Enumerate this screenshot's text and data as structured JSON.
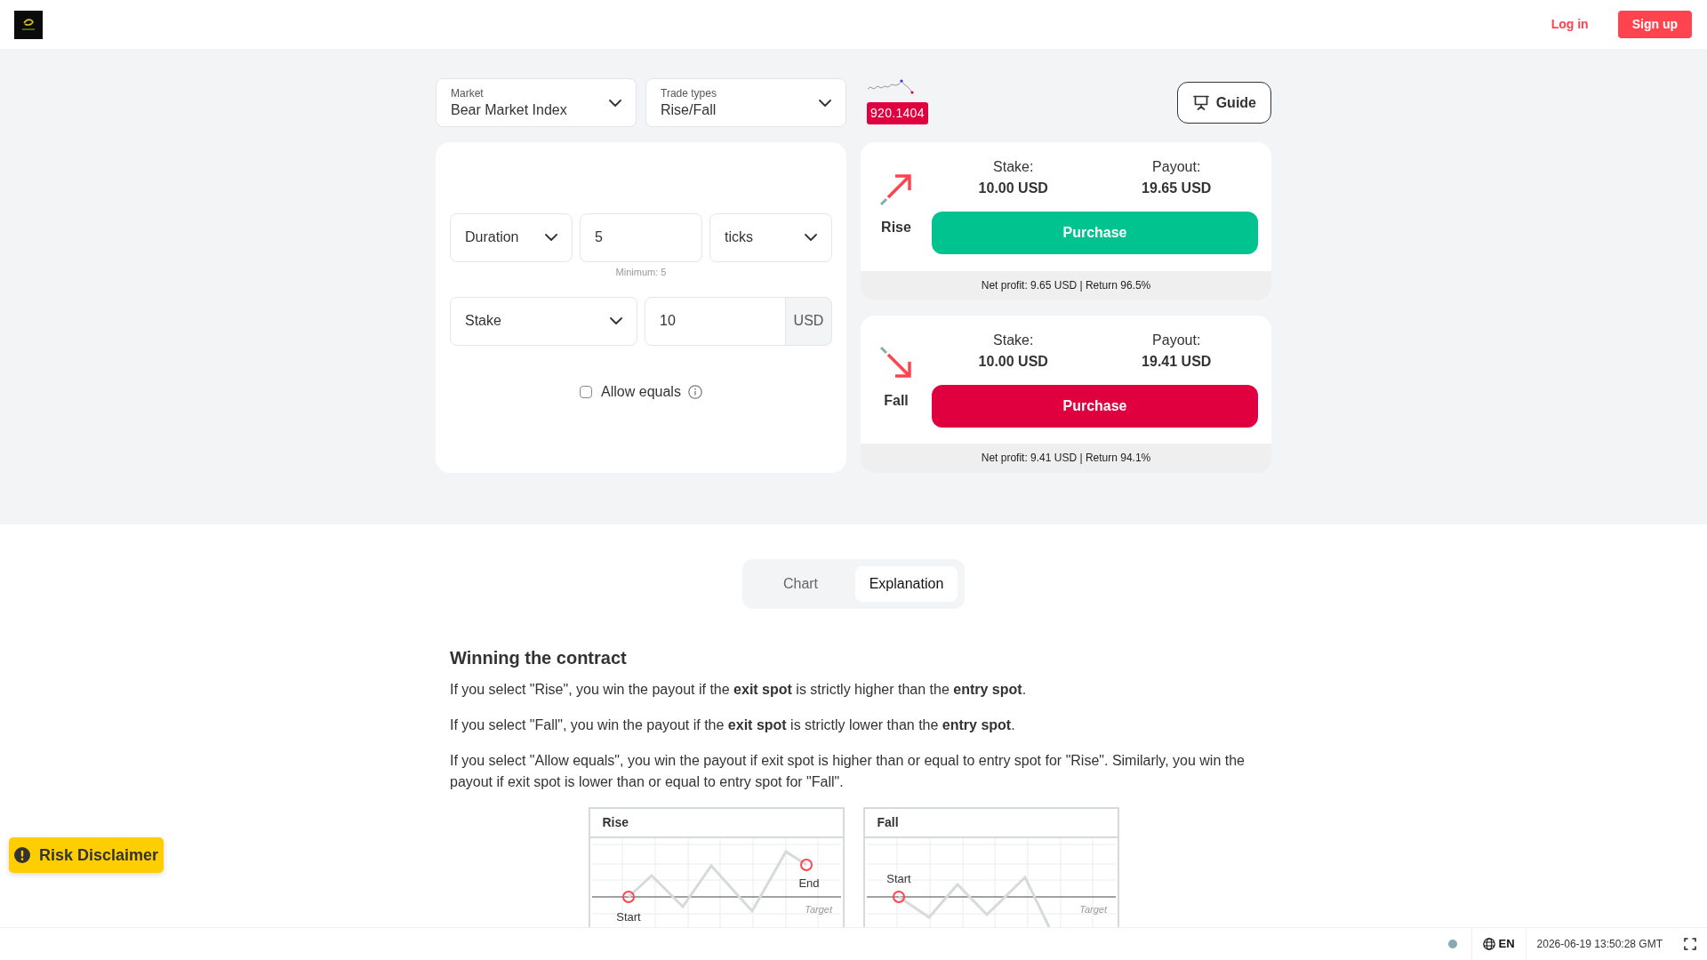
{
  "header": {
    "login": "Log in",
    "signup": "Sign up"
  },
  "trade_bar": {
    "market": {
      "label": "Market",
      "value": "Bear Market Index"
    },
    "trade_type": {
      "label": "Trade types",
      "value": "Rise/Fall"
    },
    "price": "920.1404",
    "guide": "Guide"
  },
  "form": {
    "duration": {
      "type": "Duration",
      "value": "5",
      "unit": "ticks",
      "hint": "Minimum: 5"
    },
    "stake": {
      "type": "Stake",
      "value": "10",
      "currency": "USD"
    },
    "allow_equals": {
      "label": "Allow equals",
      "checked": false
    }
  },
  "contracts": [
    {
      "kind": "rise",
      "name": "Rise",
      "stake_label": "Stake:",
      "stake": "10.00 USD",
      "payout_label": "Payout:",
      "payout": "19.65 USD",
      "button": "Purchase",
      "summary": "Net profit: 9.65 USD | Return 96.5%"
    },
    {
      "kind": "fall",
      "name": "Fall",
      "stake_label": "Stake:",
      "stake": "10.00 USD",
      "payout_label": "Payout:",
      "payout": "19.41 USD",
      "button": "Purchase",
      "summary": "Net profit: 9.41 USD | Return 94.1%"
    }
  ],
  "tabs": [
    {
      "label": "Chart",
      "selected": false
    },
    {
      "label": "Explanation",
      "selected": true
    }
  ],
  "explanation": {
    "title": "Winning the contract",
    "paragraphs": [
      "If you select \"Rise\", you win the payout if the **exit spot** is strictly higher than the **entry spot**.",
      "If you select \"Fall\", you win the payout if the **exit spot** is strictly lower than the **entry spot**.",
      "If you select \"Allow equals\", you win the payout if exit spot is higher than or equal to entry spot for \"Rise\". Similarly, you win the payout if exit spot is lower than or equal to entry spot for \"Fall\"."
    ],
    "diagrams": [
      {
        "kind": "rise",
        "title": "Rise",
        "labels": [
          {
            "kind": "start",
            "text": "Start"
          },
          {
            "kind": "end",
            "text": "End"
          },
          {
            "kind": "target",
            "text": "Target"
          }
        ]
      },
      {
        "kind": "fall",
        "title": "Fall",
        "labels": [
          {
            "kind": "start",
            "text": "Start"
          },
          {
            "kind": "target",
            "text": "Target"
          }
        ]
      }
    ]
  },
  "risk_disclaimer": "Risk Disclaimer",
  "footer": {
    "language": "EN",
    "time": "2026-06-19 13:50:28 GMT"
  }
}
